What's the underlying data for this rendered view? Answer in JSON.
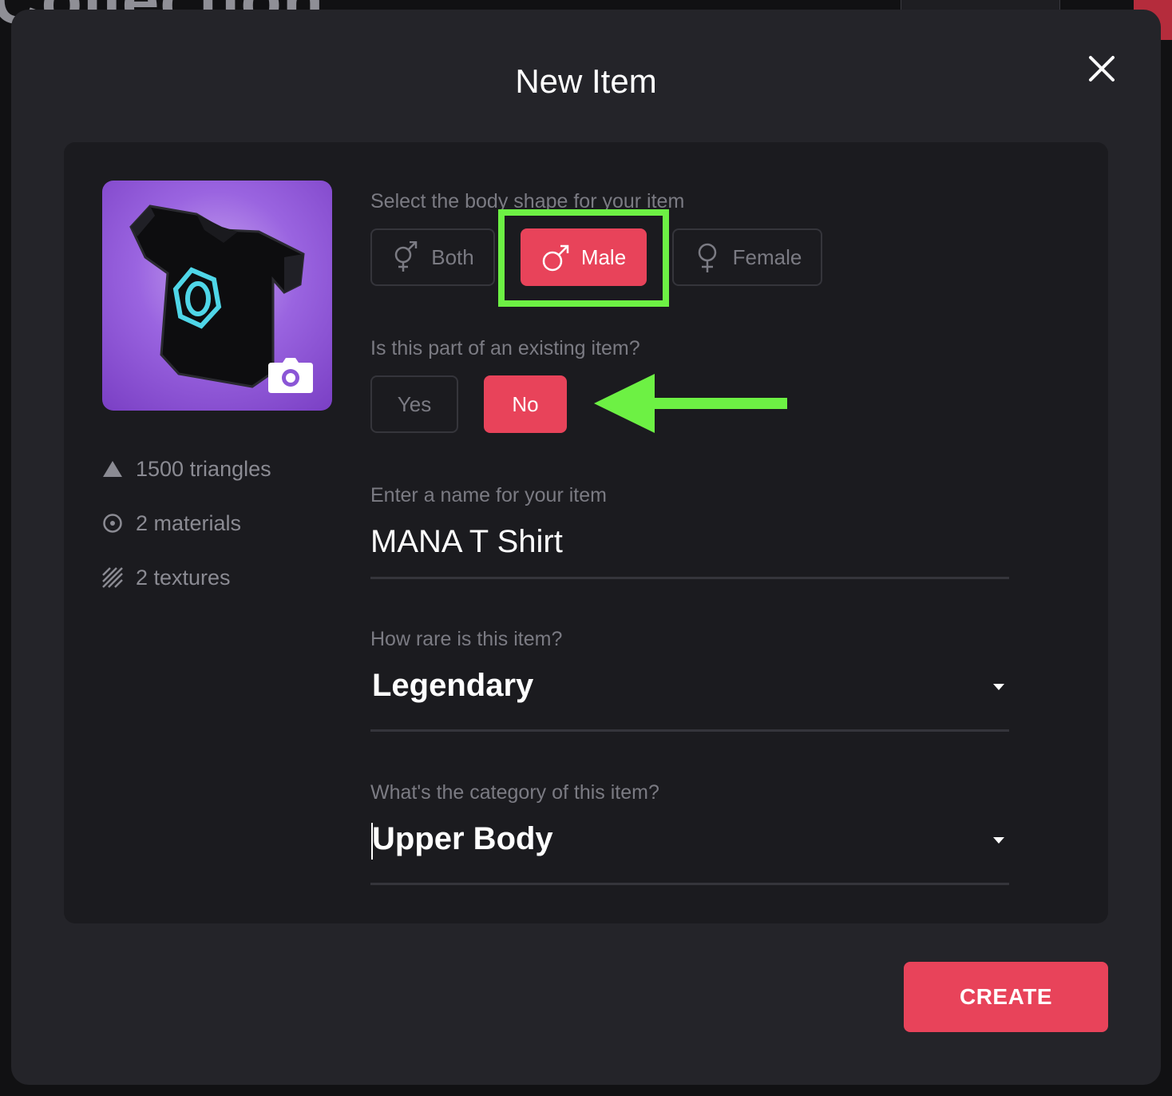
{
  "background": {
    "title_fragment": "Collection"
  },
  "modal": {
    "title": "New Item",
    "close_icon": "close-icon",
    "thumbnail": {
      "icon": "camera-icon"
    },
    "stats": [
      {
        "icon": "triangle-icon",
        "label": "1500 triangles"
      },
      {
        "icon": "materials-icon",
        "label": "2 materials"
      },
      {
        "icon": "textures-icon",
        "label": "2 textures"
      }
    ],
    "body_shape": {
      "label": "Select the body shape for your item",
      "options": [
        {
          "label": "Both",
          "icon": "both-gender-icon",
          "selected": false
        },
        {
          "label": "Male",
          "icon": "male-icon",
          "selected": true
        },
        {
          "label": "Female",
          "icon": "female-icon",
          "selected": false
        }
      ]
    },
    "existing_item": {
      "label": "Is this part of an existing item?",
      "options": [
        {
          "label": "Yes",
          "selected": false
        },
        {
          "label": "No",
          "selected": true
        }
      ]
    },
    "name": {
      "label": "Enter a name for your item",
      "value": "MANA T Shirt"
    },
    "rarity": {
      "label": "How rare is this item?",
      "value": "Legendary"
    },
    "category": {
      "label": "What's the category of this item?",
      "value": "Upper Body"
    },
    "create_label": "CREATE"
  },
  "colors": {
    "accent": "#e8435a",
    "annotation": "#6df144",
    "modal_bg": "#242429",
    "panel_bg": "#1b1b1f"
  }
}
